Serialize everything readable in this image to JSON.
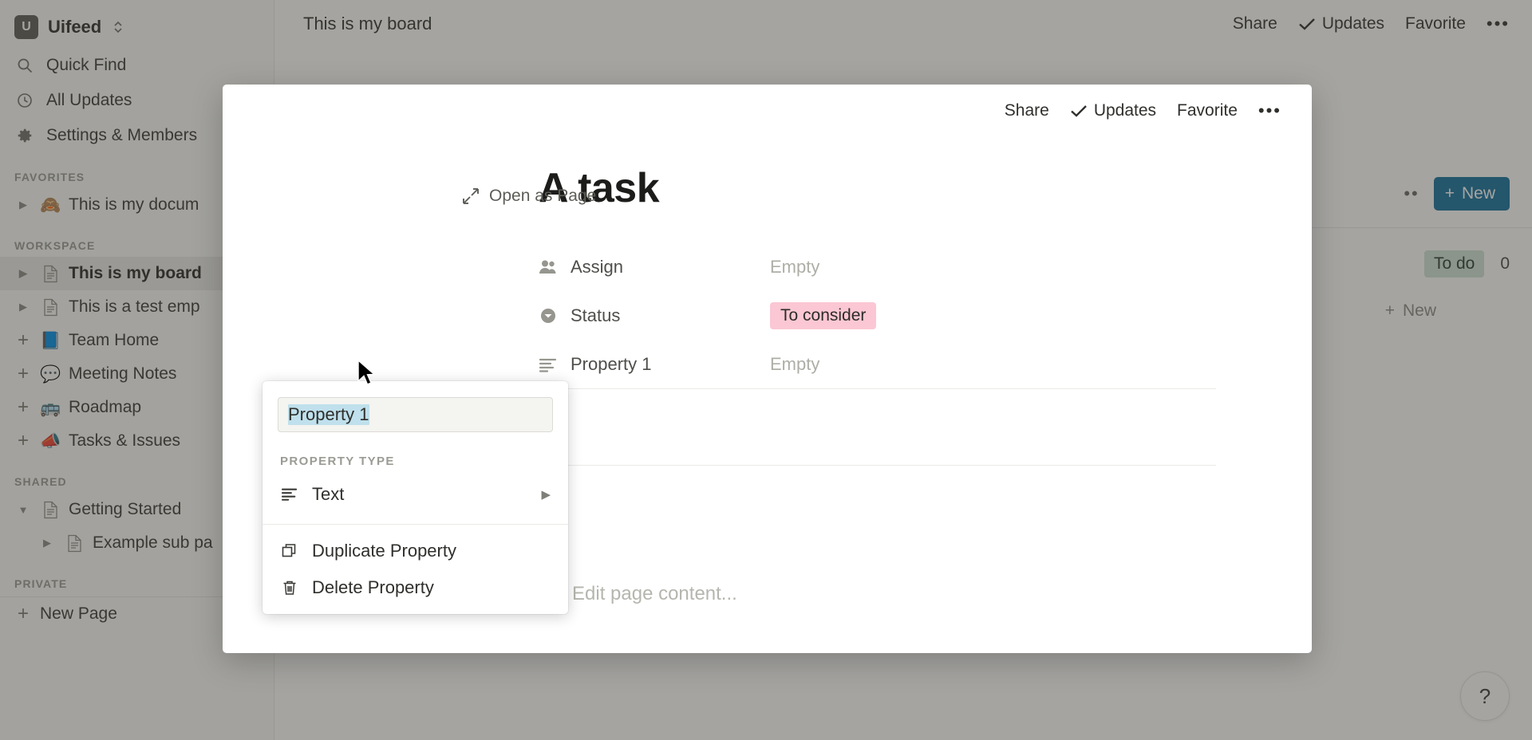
{
  "sidebar": {
    "workspace": {
      "initial": "U",
      "name": "Uifeed",
      "chevron_icon": "chevron-updown-icon"
    },
    "nav": [
      {
        "label": "Quick Find",
        "icon": "search-icon"
      },
      {
        "label": "All Updates",
        "icon": "clock-icon"
      },
      {
        "label": "Settings & Members",
        "icon": "gear-icon"
      }
    ],
    "sections": [
      {
        "label": "FAVORITES",
        "items": [
          {
            "label": "This is my docum",
            "emoji": "🙈",
            "twisty": "right",
            "kind": "emoji"
          }
        ]
      },
      {
        "label": "WORKSPACE",
        "items": [
          {
            "label": "This is my board",
            "twisty": "right",
            "kind": "doc",
            "active": true
          },
          {
            "label": "This is a test emp",
            "twisty": "right",
            "kind": "doc"
          },
          {
            "label": "Team Home",
            "emoji": "📘",
            "twisty": "plus",
            "kind": "emoji"
          },
          {
            "label": "Meeting Notes",
            "emoji": "💬",
            "twisty": "plus",
            "kind": "emoji"
          },
          {
            "label": "Roadmap",
            "emoji": "🚌",
            "twisty": "plus",
            "kind": "emoji"
          },
          {
            "label": "Tasks & Issues",
            "emoji": "📣",
            "twisty": "plus",
            "kind": "emoji"
          }
        ]
      },
      {
        "label": "SHARED",
        "items": [
          {
            "label": "Getting Started",
            "twisty": "down",
            "kind": "doc"
          },
          {
            "label": "Example sub pa",
            "twisty": "right",
            "kind": "doc",
            "indent": true
          }
        ]
      },
      {
        "label": "PRIVATE",
        "items": [
          {
            "label": "New Page",
            "twisty": "plus",
            "kind": "none"
          }
        ]
      }
    ]
  },
  "topbar": {
    "title": "This is my board",
    "share_label": "Share",
    "updates_label": "Updates",
    "updates_check_icon": "check-icon",
    "favorite_label": "Favorite",
    "more_icon": "ellipsis-icon",
    "more_label": "•••"
  },
  "board": {
    "toolbar_more": "••",
    "new_button_label": "New",
    "new_button_plus": "+",
    "new_button_color": "#15719e",
    "column": {
      "status_label": "To do",
      "status_color": "#cfe3d8",
      "count": "0"
    },
    "add_card_label": "New",
    "add_card_plus": "+",
    "help_label": "?"
  },
  "modal": {
    "open_as_page_label": "Open as Page",
    "open_as_page_icon": "expand-diagonal-icon",
    "share_label": "Share",
    "updates_label": "Updates",
    "updates_check_icon": "check-icon",
    "favorite_label": "Favorite",
    "more_label": "•••",
    "title": "A task",
    "properties": [
      {
        "label": "Assign",
        "icon": "person-icon",
        "value": "Empty",
        "type": "empty"
      },
      {
        "label": "Status",
        "icon": "select-circle-icon",
        "value": "To consider",
        "type": "chip",
        "chip_color": "#fbc7d4"
      },
      {
        "label": "Property 1",
        "icon": "text-lines-icon",
        "value": "Empty",
        "type": "empty"
      }
    ],
    "edit_hint": "Edit page content...",
    "edit_hint_icon": "pencil-icon"
  },
  "menu": {
    "input_value": "Property 1",
    "section_label": "PROPERTY TYPE",
    "type_item": {
      "label": "Text",
      "icon": "text-lines-icon",
      "caret": "▶"
    },
    "actions": [
      {
        "label": "Duplicate Property",
        "icon": "duplicate-icon"
      },
      {
        "label": "Delete Property",
        "icon": "trash-icon"
      }
    ]
  }
}
